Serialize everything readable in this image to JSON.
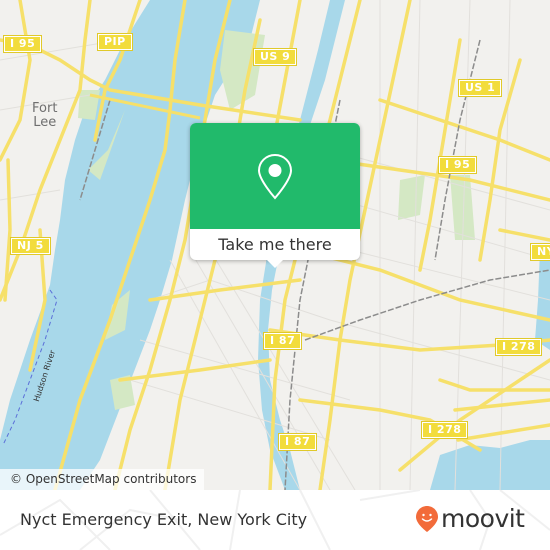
{
  "map": {
    "colors": {
      "water": "#a8d8ea",
      "land": "#f2f1ee",
      "park": "#d4e8c4",
      "road_major": "#f6e06a",
      "road_minor": "#ffffff",
      "rail": "#8c8c8c",
      "accent": "#21ba6b",
      "brand": "#f26b3a"
    },
    "shields": [
      {
        "label": "I 95"
      },
      {
        "label": "PIP"
      },
      {
        "label": "US 9"
      },
      {
        "label": "US 1"
      },
      {
        "label": "I 95"
      },
      {
        "label": "NJ 5"
      },
      {
        "label": "NY"
      },
      {
        "label": "I 87"
      },
      {
        "label": "I 278"
      },
      {
        "label": "I 278"
      },
      {
        "label": "I 87"
      }
    ],
    "places": [
      {
        "label": "Fort\nLee"
      }
    ],
    "water_labels": [
      {
        "label": "Hudson River"
      }
    ],
    "attribution": "© OpenStreetMap contributors"
  },
  "popup": {
    "icon": "location-pin-icon",
    "button_label": "Take me there"
  },
  "footer": {
    "title": "Nyct Emergency Exit, New York City",
    "brand": {
      "icon": "moovit-smile-pin-icon",
      "wordmark": "moovit"
    }
  }
}
